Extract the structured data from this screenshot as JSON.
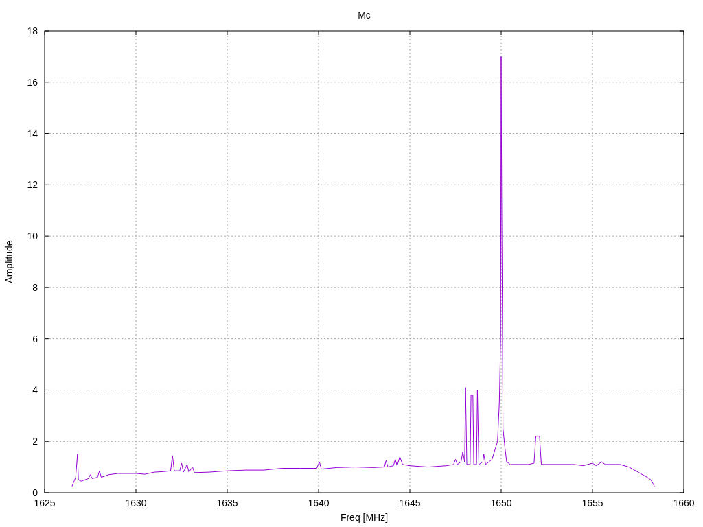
{
  "chart_data": {
    "type": "line",
    "title": "Mc",
    "xlabel": "Freq [MHz]",
    "ylabel": "Amplitude",
    "xlim": [
      1625,
      1660
    ],
    "ylim": [
      0,
      18
    ],
    "grid": true,
    "xticks": [
      1625,
      1630,
      1635,
      1640,
      1645,
      1650,
      1655,
      1660
    ],
    "yticks": [
      0,
      2,
      4,
      6,
      8,
      10,
      12,
      14,
      16,
      18
    ],
    "x": [
      1626.5,
      1626.7,
      1626.8,
      1626.85,
      1627,
      1627.4,
      1627.5,
      1627.6,
      1627.9,
      1628,
      1628.1,
      1628.5,
      1629,
      1630,
      1630.5,
      1631,
      1631.5,
      1631.9,
      1632,
      1632.1,
      1632.4,
      1632.5,
      1632.6,
      1632.8,
      1632.9,
      1633.1,
      1633.2,
      1634,
      1635,
      1636,
      1637,
      1638,
      1639,
      1639.9,
      1640.05,
      1640.15,
      1641,
      1642,
      1643,
      1643.6,
      1643.7,
      1643.8,
      1644.1,
      1644.2,
      1644.3,
      1644.45,
      1644.6,
      1645,
      1646,
      1647,
      1647.4,
      1647.5,
      1647.6,
      1647.8,
      1647.9,
      1648,
      1648.05,
      1648.12,
      1648.3,
      1648.35,
      1648.45,
      1648.5,
      1648.65,
      1648.7,
      1648.78,
      1649,
      1649.05,
      1649.15,
      1649.5,
      1649.8,
      1649.9,
      1649.97,
      1650,
      1650.03,
      1650.1,
      1650.2,
      1650.3,
      1650.5,
      1651,
      1651.5,
      1651.8,
      1651.9,
      1652.1,
      1652.2,
      1653,
      1654,
      1654.5,
      1655,
      1655.2,
      1655.5,
      1655.7,
      1656.5,
      1657,
      1657.5,
      1658,
      1658.2,
      1658.4
    ],
    "series": [
      {
        "color": "#9400d3",
        "values": [
          0.25,
          0.6,
          1.5,
          0.5,
          0.45,
          0.55,
          0.7,
          0.55,
          0.6,
          0.85,
          0.6,
          0.7,
          0.75,
          0.75,
          0.72,
          0.8,
          0.82,
          0.85,
          1.45,
          0.85,
          0.85,
          1.15,
          0.8,
          1.1,
          0.8,
          1.0,
          0.78,
          0.8,
          0.85,
          0.88,
          0.88,
          0.95,
          0.95,
          0.95,
          1.2,
          0.92,
          0.98,
          1.0,
          0.98,
          1.0,
          1.25,
          1.0,
          1.05,
          1.3,
          1.05,
          1.4,
          1.1,
          1.05,
          1.0,
          1.05,
          1.1,
          1.3,
          1.1,
          1.2,
          1.6,
          1.2,
          4.1,
          1.1,
          1.1,
          3.8,
          3.8,
          1.1,
          1.1,
          4.0,
          1.1,
          1.2,
          1.5,
          1.1,
          1.3,
          2.0,
          3.5,
          6,
          17,
          11.5,
          2.5,
          1.8,
          1.2,
          1.1,
          1.1,
          1.1,
          1.15,
          2.2,
          2.2,
          1.1,
          1.1,
          1.1,
          1.05,
          1.15,
          1.05,
          1.2,
          1.1,
          1.1,
          1.0,
          0.8,
          0.6,
          0.5,
          0.25
        ]
      }
    ]
  }
}
